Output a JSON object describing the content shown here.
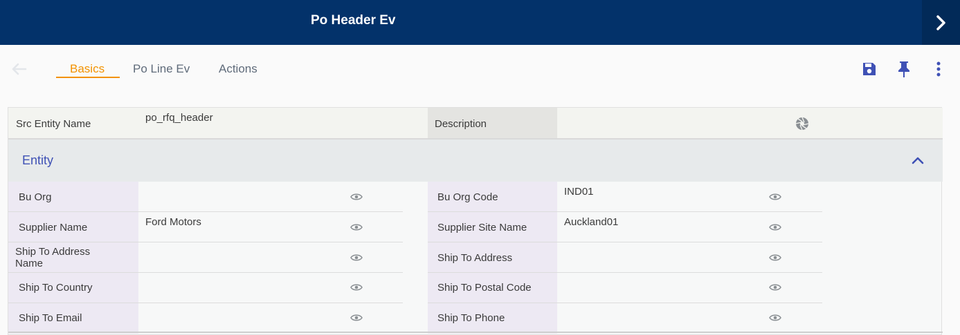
{
  "header": {
    "title": "Po Header Ev"
  },
  "tabs": [
    {
      "label": "Basics",
      "active": true
    },
    {
      "label": "Po Line Ev",
      "active": false
    },
    {
      "label": "Actions",
      "active": false
    }
  ],
  "icons": {
    "back": "arrow-left-icon",
    "save": "save-icon",
    "pin": "pin-icon",
    "more": "more-vertical-icon",
    "next": "chevron-right-icon",
    "aperture": "aperture-icon",
    "eye": "eye-icon",
    "collapse": "chevron-up-icon"
  },
  "colors": {
    "brand": "#03326a",
    "accent": "#f39200",
    "icon_blue": "#3f51b5"
  },
  "top_fields": {
    "src_entity_name_label": "Src Entity Name",
    "src_entity_name_value": "po_rfq_header",
    "description_label": "Description",
    "description_value": ""
  },
  "section": {
    "title": "Entity"
  },
  "fields": [
    {
      "left_label": "Bu Org",
      "left_value": "",
      "right_label": "Bu Org Code",
      "right_value": "IND01"
    },
    {
      "left_label": "Supplier Name",
      "left_value": "Ford Motors",
      "right_label": "Supplier Site Name",
      "right_value": "Auckland01"
    },
    {
      "left_label": "Ship To Address Name",
      "left_value": "",
      "right_label": "Ship To Address",
      "right_value": ""
    },
    {
      "left_label": "Ship To Country",
      "left_value": "",
      "right_label": "Ship To Postal Code",
      "right_value": ""
    },
    {
      "left_label": "Ship To Email",
      "left_value": "",
      "right_label": "Ship To Phone",
      "right_value": ""
    }
  ]
}
